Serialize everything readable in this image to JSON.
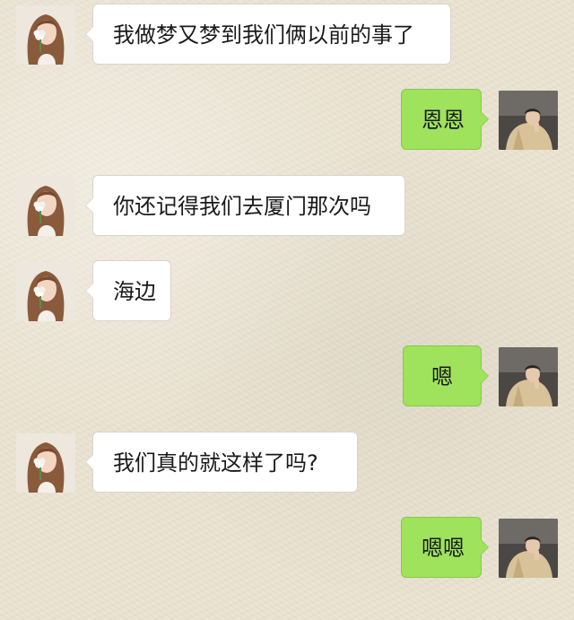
{
  "messages": [
    {
      "side": "left",
      "text": "我做梦又梦到我们俩以前的事了",
      "avatar": "girl-with-flower-avatar"
    },
    {
      "side": "right",
      "text": "恩恩",
      "avatar": "boy-avatar"
    },
    {
      "side": "left",
      "text": "你还记得我们去厦门那次吗",
      "avatar": "girl-with-flower-avatar"
    },
    {
      "side": "left",
      "text": "海边",
      "avatar": "girl-with-flower-avatar"
    },
    {
      "side": "right",
      "text": "嗯",
      "avatar": "boy-avatar"
    },
    {
      "side": "left",
      "text": "我们真的就这样了吗?",
      "avatar": "girl-with-flower-avatar"
    },
    {
      "side": "right",
      "text": "嗯嗯",
      "avatar": "boy-avatar"
    }
  ],
  "colors": {
    "background": "#ece4d2",
    "incoming_bubble": "#ffffff",
    "outgoing_bubble": "#9fe35c"
  }
}
